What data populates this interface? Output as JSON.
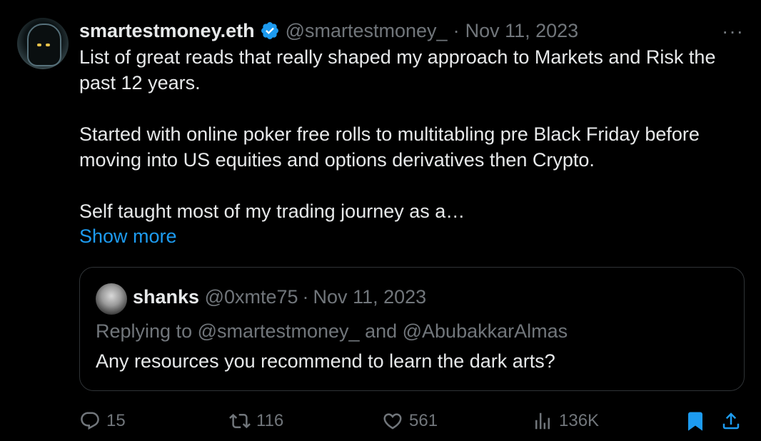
{
  "tweet": {
    "author_name": "smartestmoney.eth",
    "handle": "@smartestmoney_",
    "separator": "·",
    "date": "Nov 11, 2023",
    "more_icon": "more-horizontal-icon",
    "more_glyph": "···",
    "paragraphs": [
      "List of great reads that really shaped my approach to Markets and Risk the past 12 years.",
      "Started with online poker free rolls to multitabling pre Black Friday before moving into US equities and options derivatives then Crypto.",
      "Self taught most of my trading journey as a…"
    ],
    "show_more": "Show more",
    "verified_color": "#1d9bf0"
  },
  "quoted": {
    "author_name": "shanks",
    "handle": "@0xmte75",
    "separator": "·",
    "date": "Nov 11, 2023",
    "replying_to": "Replying to @smartestmoney_ and @AbubakkarAlmas",
    "text": "Any resources you recommend to learn the dark arts?"
  },
  "actions": {
    "reply_count": "15",
    "retweet_count": "116",
    "like_count": "561",
    "views_count": "136K"
  }
}
